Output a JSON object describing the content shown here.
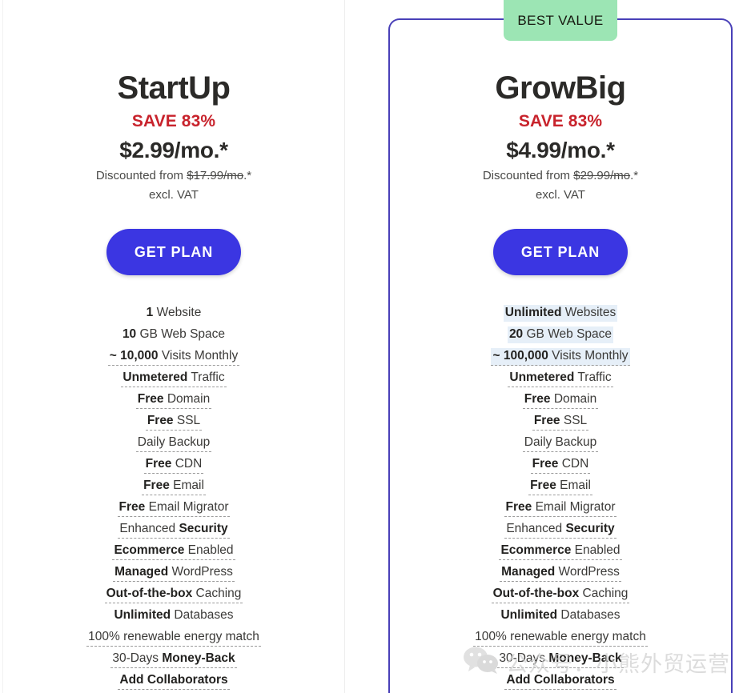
{
  "page": {
    "background": "#ffffff",
    "accent_button": "#3b36e2",
    "highlight_border": "#4940b8",
    "badge_bg": "#9ce5b4",
    "save_color": "#c8232c",
    "feature_highlight_bg": "#e6eff8"
  },
  "badge": {
    "label": "BEST VALUE"
  },
  "plans": [
    {
      "key": "startup",
      "name": "StartUp",
      "save": "SAVE 83%",
      "price": "$2.99/mo.*",
      "discount_prefix": "Discounted from ",
      "discount_struck": "$17.99/mo",
      "discount_suffix": ".*",
      "vat": "excl. VAT",
      "cta": "GET PLAN",
      "features": [
        {
          "bold": "1",
          "rest": " Website",
          "dashed": false,
          "highlight": false
        },
        {
          "bold": "10",
          "rest": " GB Web Space",
          "dashed": false,
          "highlight": false
        },
        {
          "bold": "~ 10,000",
          "rest": " Visits Monthly",
          "dashed": true,
          "highlight": false
        },
        {
          "bold": "Unmetered",
          "rest": " Traffic",
          "dashed": true,
          "highlight": false
        },
        {
          "bold": "Free",
          "rest": " Domain",
          "dashed": true,
          "highlight": false
        },
        {
          "bold": "Free",
          "rest": " SSL",
          "dashed": true,
          "highlight": false
        },
        {
          "bold": "",
          "rest": "Daily Backup",
          "dashed": true,
          "highlight": false
        },
        {
          "bold": "Free",
          "rest": " CDN",
          "dashed": true,
          "highlight": false
        },
        {
          "bold": "Free",
          "rest": " Email",
          "dashed": true,
          "highlight": false
        },
        {
          "bold": "Free",
          "rest": " Email Migrator",
          "dashed": true,
          "highlight": false
        },
        {
          "bold": "",
          "rest": "Enhanced ",
          "bold_after": "Security",
          "dashed": true,
          "highlight": false
        },
        {
          "bold": "Ecommerce",
          "rest": " Enabled",
          "dashed": true,
          "highlight": false
        },
        {
          "bold": "Managed",
          "rest": " WordPress",
          "dashed": true,
          "highlight": false
        },
        {
          "bold": "Out-of-the-box",
          "rest": " Caching",
          "dashed": true,
          "highlight": false
        },
        {
          "bold": "Unlimited",
          "rest": " Databases",
          "dashed": false,
          "highlight": false
        },
        {
          "bold": "",
          "rest": "100% renewable energy match",
          "dashed": true,
          "highlight": false
        },
        {
          "bold": "",
          "rest": "30-Days ",
          "bold_after": "Money-Back",
          "dashed": true,
          "highlight": false
        },
        {
          "bold": "Add Collaborators",
          "rest": "",
          "dashed": true,
          "highlight": false
        }
      ]
    },
    {
      "key": "growbig",
      "name": "GrowBig",
      "save": "SAVE 83%",
      "price": "$4.99/mo.*",
      "discount_prefix": "Discounted from ",
      "discount_struck": "$29.99/mo",
      "discount_suffix": ".*",
      "vat": "excl. VAT",
      "cta": "GET PLAN",
      "features": [
        {
          "bold": "Unlimited",
          "rest": " Websites",
          "dashed": false,
          "highlight": true
        },
        {
          "bold": "20",
          "rest": " GB Web Space",
          "dashed": false,
          "highlight": true
        },
        {
          "bold": "~ 100,000",
          "rest": " Visits Monthly",
          "dashed": true,
          "highlight": true
        },
        {
          "bold": "Unmetered",
          "rest": " Traffic",
          "dashed": true,
          "highlight": false
        },
        {
          "bold": "Free",
          "rest": " Domain",
          "dashed": true,
          "highlight": false
        },
        {
          "bold": "Free",
          "rest": " SSL",
          "dashed": true,
          "highlight": false
        },
        {
          "bold": "",
          "rest": "Daily Backup",
          "dashed": true,
          "highlight": false
        },
        {
          "bold": "Free",
          "rest": " CDN",
          "dashed": true,
          "highlight": false
        },
        {
          "bold": "Free",
          "rest": " Email",
          "dashed": true,
          "highlight": false
        },
        {
          "bold": "Free",
          "rest": " Email Migrator",
          "dashed": true,
          "highlight": false
        },
        {
          "bold": "",
          "rest": "Enhanced ",
          "bold_after": "Security",
          "dashed": true,
          "highlight": false
        },
        {
          "bold": "Ecommerce",
          "rest": " Enabled",
          "dashed": true,
          "highlight": false
        },
        {
          "bold": "Managed",
          "rest": " WordPress",
          "dashed": true,
          "highlight": false
        },
        {
          "bold": "Out-of-the-box",
          "rest": " Caching",
          "dashed": true,
          "highlight": false
        },
        {
          "bold": "Unlimited",
          "rest": " Databases",
          "dashed": false,
          "highlight": false
        },
        {
          "bold": "",
          "rest": "100% renewable energy match",
          "dashed": true,
          "highlight": false
        },
        {
          "bold": "",
          "rest": "30-Days ",
          "bold_after": "Money-Back",
          "dashed": true,
          "highlight": false
        },
        {
          "bold": "Add Collaborators",
          "rest": "",
          "dashed": true,
          "highlight": false
        }
      ]
    }
  ],
  "watermark": {
    "text": "公众号：小熊外贸运营",
    "icon": "wechat-icon"
  }
}
